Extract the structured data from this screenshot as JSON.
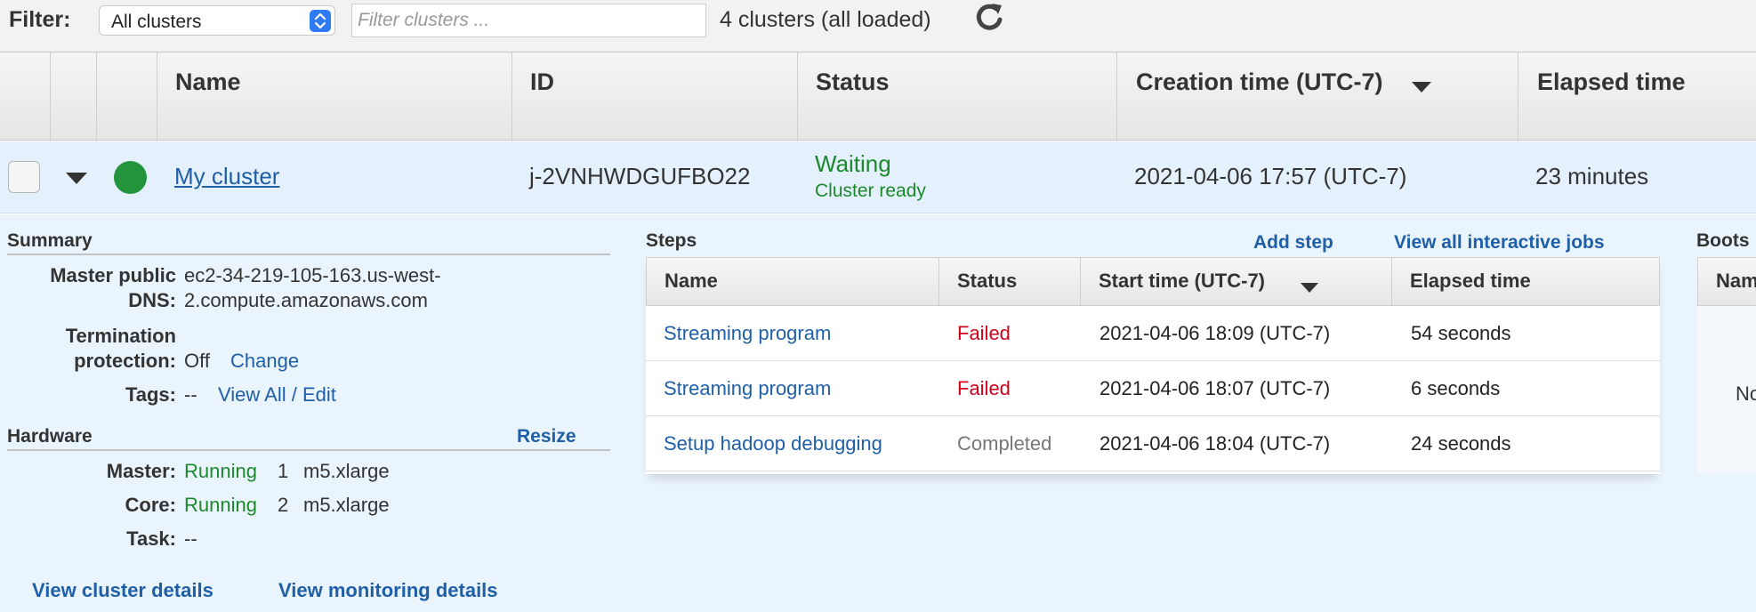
{
  "filter": {
    "label": "Filter:",
    "select_value": "All clusters",
    "search_placeholder": "Filter clusters ...",
    "count_text": "4 clusters (all loaded)"
  },
  "table": {
    "columns": [
      "Name",
      "ID",
      "Status",
      "Creation time (UTC-7)",
      "Elapsed time"
    ]
  },
  "cluster": {
    "name": "My cluster",
    "id": "j-2VNHWDGUFBO22",
    "status": "Waiting",
    "status_detail": "Cluster ready",
    "creation_time": "2021-04-06 17:57 (UTC-7)",
    "elapsed": "23 minutes"
  },
  "summary": {
    "heading": "Summary",
    "dns_key_1": "Master public",
    "dns_key_2": "DNS:",
    "dns_val_1": "ec2-34-219-105-163.us-west-",
    "dns_val_2": "2.compute.amazonaws.com",
    "term_key_1": "Termination",
    "term_key_2": "protection:",
    "term_val": "Off",
    "term_change": "Change",
    "tags_key": "Tags:",
    "tags_val": "--",
    "tags_link": "View All / Edit"
  },
  "hardware": {
    "heading": "Hardware",
    "resize": "Resize",
    "master_key": "Master:",
    "master_state": "Running",
    "master_count": "1",
    "master_type": "m5.xlarge",
    "core_key": "Core:",
    "core_state": "Running",
    "core_count": "2",
    "core_type": "m5.xlarge",
    "task_key": "Task:",
    "task_val": "--"
  },
  "footer_links": {
    "cluster_details": "View cluster details",
    "monitoring_details": "View monitoring details"
  },
  "steps": {
    "heading": "Steps",
    "add_step": "Add step",
    "view_jobs": "View all interactive jobs",
    "columns": [
      "Name",
      "Status",
      "Start time (UTC-7)",
      "Elapsed time"
    ],
    "rows": [
      {
        "name": "Streaming program",
        "status": "Failed",
        "start": "2021-04-06 18:09 (UTC-7)",
        "elapsed": "54 seconds"
      },
      {
        "name": "Streaming program",
        "status": "Failed",
        "start": "2021-04-06 18:07 (UTC-7)",
        "elapsed": "6 seconds"
      },
      {
        "name": "Setup hadoop debugging",
        "status": "Completed",
        "start": "2021-04-06 18:04 (UTC-7)",
        "elapsed": "24 seconds"
      }
    ]
  },
  "bootstrap": {
    "heading": "Boots",
    "col": "Nam",
    "empty": "No"
  },
  "colors": {
    "link": "#1f5fa8",
    "running": "#1b8a2d",
    "failed": "#d0021b",
    "completed": "#777777",
    "row_selected": "#e4f0fb"
  }
}
